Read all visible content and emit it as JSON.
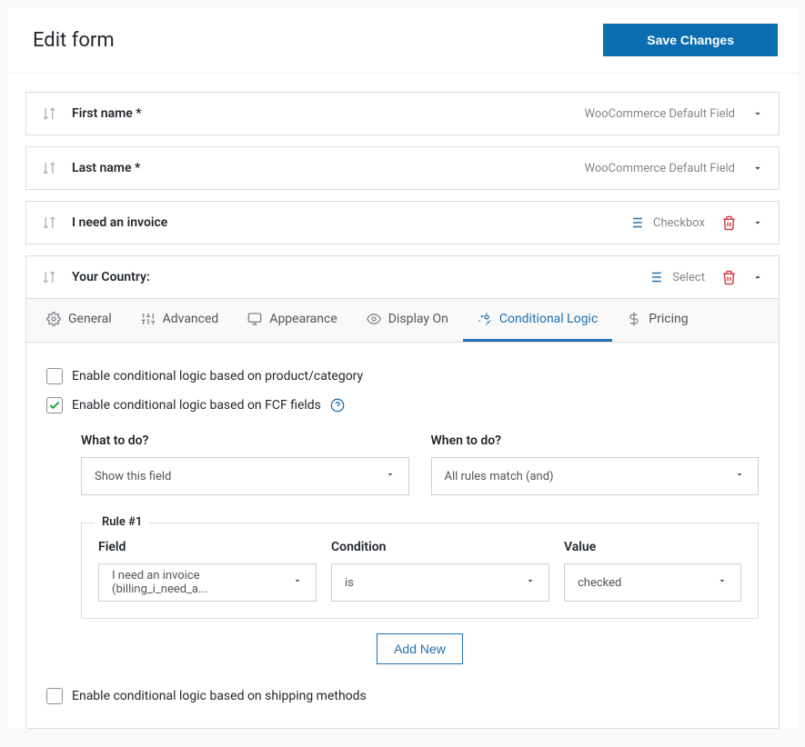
{
  "header": {
    "title": "Edit form",
    "save_label": "Save Changes"
  },
  "fields": [
    {
      "label": "First name *",
      "type": "WooCommerce Default Field",
      "has_type_icon": false,
      "has_trash": false,
      "expanded": false
    },
    {
      "label": "Last name *",
      "type": "WooCommerce Default Field",
      "has_type_icon": false,
      "has_trash": false,
      "expanded": false
    },
    {
      "label": "I need an invoice",
      "type": "Checkbox",
      "has_type_icon": true,
      "has_trash": true,
      "expanded": false
    },
    {
      "label": "Your Country:",
      "type": "Select",
      "has_type_icon": true,
      "has_trash": true,
      "expanded": true
    }
  ],
  "tabs": [
    {
      "label": "General"
    },
    {
      "label": "Advanced"
    },
    {
      "label": "Appearance"
    },
    {
      "label": "Display On"
    },
    {
      "label": "Conditional Logic"
    },
    {
      "label": "Pricing"
    }
  ],
  "conditional": {
    "enable_product_label": "Enable conditional logic based on product/category",
    "enable_fcf_label": "Enable conditional logic based on FCF fields",
    "enable_shipping_label": "Enable conditional logic based on shipping methods",
    "what_label": "What to do?",
    "what_value": "Show this field",
    "when_label": "When to do?",
    "when_value": "All rules match (and)",
    "rule_title": "Rule #1",
    "field_label": "Field",
    "field_value": "I need an invoice (billing_i_need_a...",
    "condition_label": "Condition",
    "condition_value": "is",
    "value_label": "Value",
    "value_value": "checked",
    "add_new_label": "Add New"
  }
}
